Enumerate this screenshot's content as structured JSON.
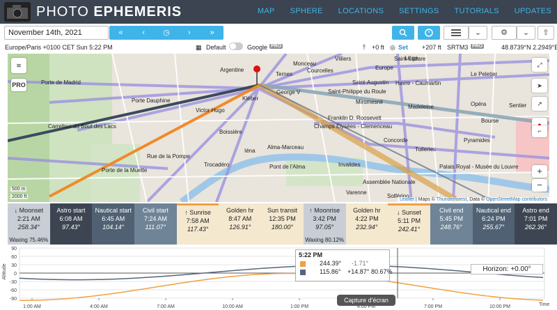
{
  "app": {
    "brand_light": "PHOTO",
    "brand_bold": "EPHEMERIS",
    "nav": [
      "MAP",
      "SPHERE",
      "LOCATIONS",
      "SETTINGS",
      "TUTORIALS",
      "UPDATES"
    ]
  },
  "toolbar": {
    "date": "November 14th, 2021",
    "icons": [
      "fast-back-icon",
      "back-icon",
      "now-icon",
      "forward-icon",
      "fast-forward-icon"
    ]
  },
  "info": {
    "timezone": "Europe/Paris +0100 CET Sun 5:22 PM",
    "default_label": "Default",
    "google_label": "Google",
    "pro": "PRO",
    "height": "+0 ft",
    "set_label": "Set",
    "elevation": "+207 ft",
    "dem": "SRTM3",
    "dem_pro": "PRO",
    "coords": "48.8739°N 2.2949°E"
  },
  "map": {
    "pro_btn": "PRO",
    "scale_m": "500 m",
    "scale_ft": "2000 ft",
    "attribution_leaflet": "Leaflet",
    "attribution_mid": " | Maps © ",
    "attribution_tf": "Thunderforest",
    "attribution_data": ", Data © ",
    "attribution_osm": "OpenStreetMap contributors",
    "places": [
      {
        "t": "Argentine"
      },
      {
        "t": "Porte de Madrid"
      },
      {
        "t": "Porte Dauphine"
      },
      {
        "t": "Victor Hugo"
      },
      {
        "t": "Kléber"
      },
      {
        "t": "George V"
      },
      {
        "t": "Carrefour du Bout des Lacs"
      },
      {
        "t": "Boissière"
      },
      {
        "t": "Franklin D. Roosevelt"
      },
      {
        "t": "Champs Élysées - Clemenceau"
      },
      {
        "t": "Iéna"
      },
      {
        "t": "Alma-Marceau"
      },
      {
        "t": "Rue de la Pompe"
      },
      {
        "t": "Trocadéro"
      },
      {
        "t": "Pont de l'Alma"
      },
      {
        "t": "Invalides"
      },
      {
        "t": "Assemblée Nationale"
      },
      {
        "t": "Porte de la Muette"
      },
      {
        "t": "Concorde"
      },
      {
        "t": "Palais Royal - Musée du Louvre"
      },
      {
        "t": "Saint-Lazare"
      },
      {
        "t": "Havre - Caumartin"
      },
      {
        "t": "Saint-Augustin"
      },
      {
        "t": "Saint-Philippe du Roule"
      },
      {
        "t": "Madeleine"
      },
      {
        "t": "Tuileries"
      },
      {
        "t": "Opéra"
      },
      {
        "t": "Pyramides"
      },
      {
        "t": "Bourse"
      },
      {
        "t": "Solférino"
      },
      {
        "t": "Liège"
      },
      {
        "t": "Europe"
      },
      {
        "t": "Villiers"
      },
      {
        "t": "Monceau"
      },
      {
        "t": "Le Peletier"
      },
      {
        "t": "Sentier"
      },
      {
        "t": "Miromesnil"
      },
      {
        "t": "Varenne"
      },
      {
        "t": "Ternes"
      },
      {
        "t": "Courcelles"
      }
    ]
  },
  "events": [
    {
      "label": "Moonset",
      "icon": "↓",
      "time": "2:21 AM",
      "az": "258.34°",
      "extra": "Waxing 75.46%",
      "bg": "#c9ced6",
      "fg": "#222",
      "top": ""
    },
    {
      "label": "Astro start",
      "icon": "",
      "time": "6:08 AM",
      "az": "97.43°",
      "extra": "",
      "bg": "#3d4552",
      "fg": "#fff",
      "top": ""
    },
    {
      "label": "Nautical start",
      "icon": "",
      "time": "6:45 AM",
      "az": "104.14°",
      "extra": "",
      "bg": "#4f6172",
      "fg": "#fff",
      "top": ""
    },
    {
      "label": "Civil start",
      "icon": "",
      "time": "7:24 AM",
      "az": "111.07°",
      "extra": "",
      "bg": "#6f8497",
      "fg": "#fff",
      "top": ""
    },
    {
      "label": "Sunrise",
      "icon": "↑",
      "time": "7:58 AM",
      "az": "117.43°",
      "extra": "",
      "bg": "#f4e8cf",
      "fg": "#222",
      "top": "#f0a040"
    },
    {
      "label": "Golden hr",
      "icon": "",
      "time": "8:47 AM",
      "az": "126.91°",
      "extra": "",
      "bg": "#f4e8cf",
      "fg": "#222",
      "top": ""
    },
    {
      "label": "Sun transit",
      "icon": "",
      "time": "12:35 PM",
      "az": "180.00°",
      "extra": "",
      "bg": "#f4e8cf",
      "fg": "#222",
      "top": ""
    },
    {
      "label": "Moonrise",
      "icon": "↑",
      "time": "3:42 PM",
      "az": "97.05°",
      "extra": "Waxing 80.12%",
      "bg": "#c9ced6",
      "fg": "#222",
      "top": ""
    },
    {
      "label": "Golden hr",
      "icon": "",
      "time": "4:22 PM",
      "az": "232.94°",
      "extra": "",
      "bg": "#f4e8cf",
      "fg": "#222",
      "top": ""
    },
    {
      "label": "Sunset",
      "icon": "↓",
      "time": "5:11 PM",
      "az": "242.41°",
      "extra": "",
      "bg": "#f4e8cf",
      "fg": "#222",
      "top": "#f0a040"
    },
    {
      "label": "Civil end",
      "icon": "",
      "time": "5:45 PM",
      "az": "248.76°",
      "extra": "",
      "bg": "#6f8497",
      "fg": "#fff",
      "top": ""
    },
    {
      "label": "Nautical end",
      "icon": "",
      "time": "6:24 PM",
      "az": "255.67°",
      "extra": "",
      "bg": "#4f6172",
      "fg": "#fff",
      "top": ""
    },
    {
      "label": "Astro end",
      "icon": "",
      "time": "7:01 PM",
      "az": "262.36°",
      "extra": "",
      "bg": "#3d4552",
      "fg": "#fff",
      "top": ""
    }
  ],
  "chart": {
    "ticks_y": [
      "90",
      "60",
      "30",
      "0",
      "-30",
      "-60",
      "-90"
    ],
    "ticks_x": [
      "1:00 AM",
      "4:00 AM",
      "7:00 AM",
      "10:00 AM",
      "1:00 PM",
      "4:00 PM",
      "7:00 PM",
      "10:00 PM"
    ],
    "time_label": "Time",
    "ylabel": "Altitude",
    "horizon": "Horizon: +0.00°",
    "tooltip": {
      "time": "5:22 PM",
      "sun_az": "244.39°",
      "sun_alt": "-1.71°",
      "moon_az": "115.86°",
      "moon_alt": "+14.87°",
      "moon_ill": "80.67%",
      "sun_color": "#f0a040",
      "moon_color": "#56657a"
    },
    "capture": "Capture d'écran"
  }
}
